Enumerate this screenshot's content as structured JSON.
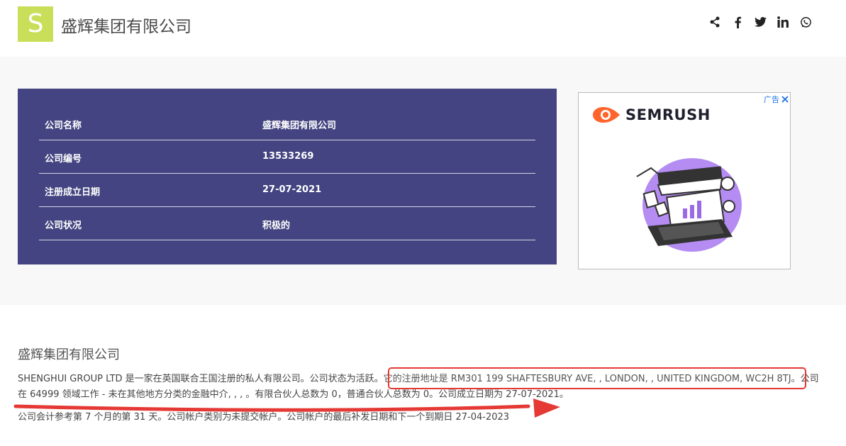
{
  "header": {
    "logo_letter": "S",
    "site_title": "盛辉集团有限公司",
    "social_icons": [
      "share-icon",
      "facebook-icon",
      "twitter-icon",
      "linkedin-icon",
      "whatsapp-icon"
    ]
  },
  "info_table": {
    "rows": [
      {
        "label": "公司名称",
        "value": "盛辉集团有限公司"
      },
      {
        "label": "公司编号",
        "value": "13533269"
      },
      {
        "label": "注册成立日期",
        "value": "27-07-2021"
      },
      {
        "label": "公司状况",
        "value": "积极的"
      }
    ]
  },
  "ad": {
    "tag": "广告",
    "brand": "SEMRUSH"
  },
  "about": {
    "title": "盛辉集团有限公司",
    "line1_a": "SHENGHUI GROUP LTD 是一家在英国联合王国注册的私人有限公司。公司状态为活跃。",
    "line1_b": "它的注册地址是 RM301 199 SHAFTESBURY AVE, , LONDON, , UNITED KINGDOM, WC2H 8TJ。",
    "line1_c": "公司",
    "line2": "在 64999 领域工作 - 未在其他地方分类的金融中介, , , 。有限合伙人总数为 0，普通合伙人总数为 0。公司成立日期为 27-07-2021。",
    "line3": "公司会计参考第 7 个月的第 31 天。公司帐户类别为未提交帐户。公司帐户的最后补发日期和下一个到期日 27-04-2023"
  },
  "colors": {
    "logo_bg": "#c9df5a",
    "card_bg": "#434481",
    "annotation_red": "#e53935"
  }
}
